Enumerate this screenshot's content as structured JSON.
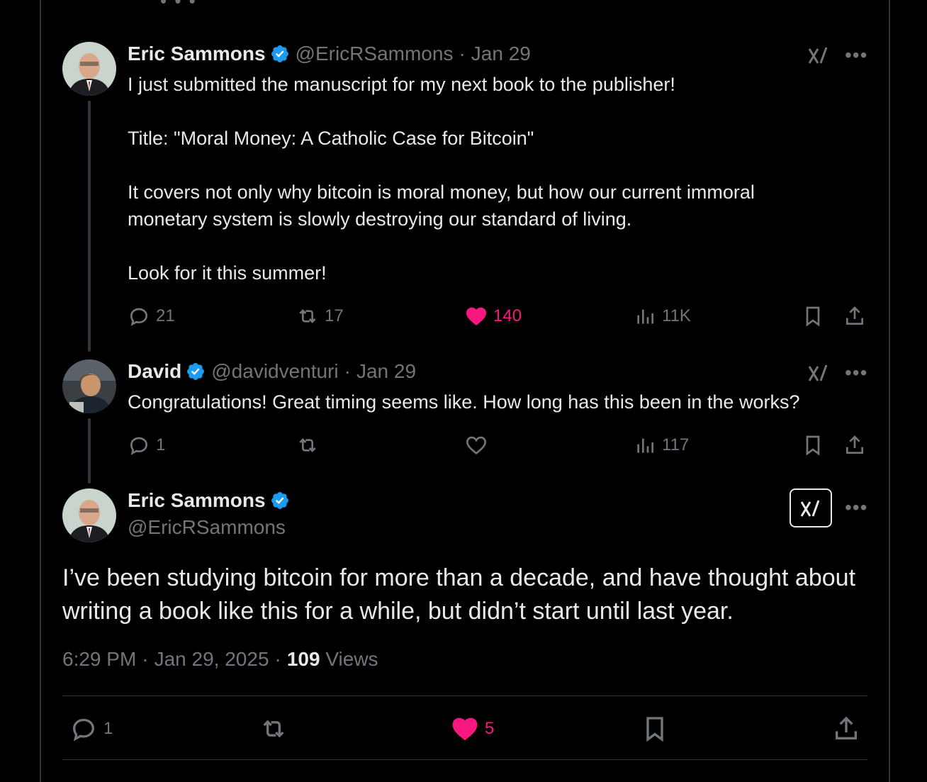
{
  "tweets": [
    {
      "name": "Eric Sammons",
      "handle": "@EricRSammons",
      "date": "Jan 29",
      "text": "I just submitted the manuscript for my next book to the publisher!\n\nTitle: \"Moral Money: A Catholic Case for Bitcoin\"\n\nIt covers not only why bitcoin is moral money, but how our current immoral\nmonetary system is slowly destroying our standard of living.\n\nLook for it this summer!",
      "replies": "21",
      "retweets": "17",
      "likes": "140",
      "views": "11K"
    },
    {
      "name": "David",
      "handle": "@davidventuri",
      "date": "Jan 29",
      "text": "Congratulations! Great timing seems like. How long has this been in the works?",
      "replies": "1",
      "retweets": "",
      "likes": "",
      "views": "117"
    }
  ],
  "focused": {
    "name": "Eric Sammons",
    "handle": "@EricRSammons",
    "text": "I’ve been studying bitcoin for more than a decade, and have thought about writing a book like this for a while, but didn’t start until last year.",
    "time": "6:29 PM",
    "date": "Jan 29, 2025",
    "views_count": "109",
    "views_label": "Views",
    "replies": "1",
    "likes": "5"
  },
  "separator": "·",
  "colors": {
    "background": "#000000",
    "text": "#e7e9ea",
    "muted": "#71767b",
    "like": "#f91880",
    "verified": "#1d9bf0"
  }
}
